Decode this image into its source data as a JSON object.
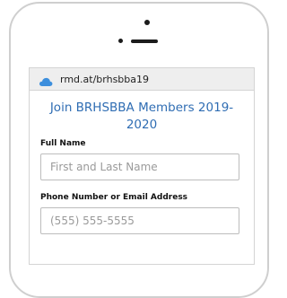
{
  "browser": {
    "url": "rmd.at/brhsbba19",
    "icon": "cloud-icon",
    "icon_color": "#3d8fdd"
  },
  "form": {
    "title": "Join BRHSBBA Members 2019-2020",
    "title_color": "#2f6db3",
    "fields": [
      {
        "label": "Full Name",
        "placeholder": "First and Last Name",
        "value": ""
      },
      {
        "label": "Phone Number or Email Address",
        "placeholder": "(555) 555-5555",
        "value": ""
      }
    ]
  }
}
